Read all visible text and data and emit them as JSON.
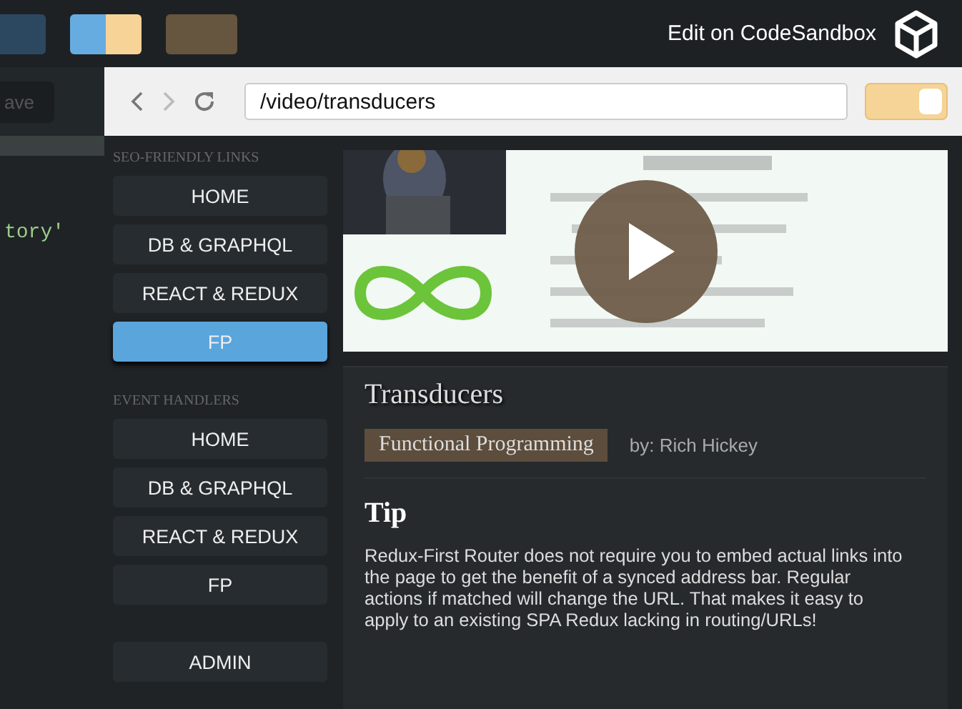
{
  "top_bar": {
    "swatches": [
      {
        "parts": [
          {
            "color": "#2c4861"
          }
        ]
      },
      {
        "parts": [
          {
            "color": "#67ace0"
          },
          {
            "color": "#f7d398"
          }
        ]
      },
      {
        "parts": [
          {
            "color": "#66553f"
          }
        ]
      }
    ],
    "edit_link": "Edit on CodeSandbox"
  },
  "editor": {
    "save_button": "ave",
    "code_text": "tory'"
  },
  "browser": {
    "url": "/video/transducers",
    "toggle_on": true
  },
  "sidebar": {
    "sections": [
      {
        "heading": "SEO-FRIENDLY LINKS",
        "items": [
          {
            "label": "HOME",
            "selected": false
          },
          {
            "label": "DB & GRAPHQL",
            "selected": false
          },
          {
            "label": "REACT & REDUX",
            "selected": false
          },
          {
            "label": "FP",
            "selected": true
          }
        ]
      },
      {
        "heading": "EVENT HANDLERS",
        "items": [
          {
            "label": "HOME",
            "selected": false
          },
          {
            "label": "DB & GRAPHQL",
            "selected": false
          },
          {
            "label": "REACT & REDUX",
            "selected": false
          },
          {
            "label": "FP",
            "selected": false
          }
        ]
      }
    ],
    "admin": "ADMIN"
  },
  "details": {
    "title": "Transducers",
    "category": "Functional Programming",
    "author": "by: Rich Hickey",
    "tip_heading": "Tip",
    "tip_text": "Redux-First Router does not require you to embed actual links into the page to get the benefit of a synced address bar. Regular actions if matched will change the URL. That makes it easy to apply to an existing SPA Redux lacking in routing/URLs!"
  }
}
